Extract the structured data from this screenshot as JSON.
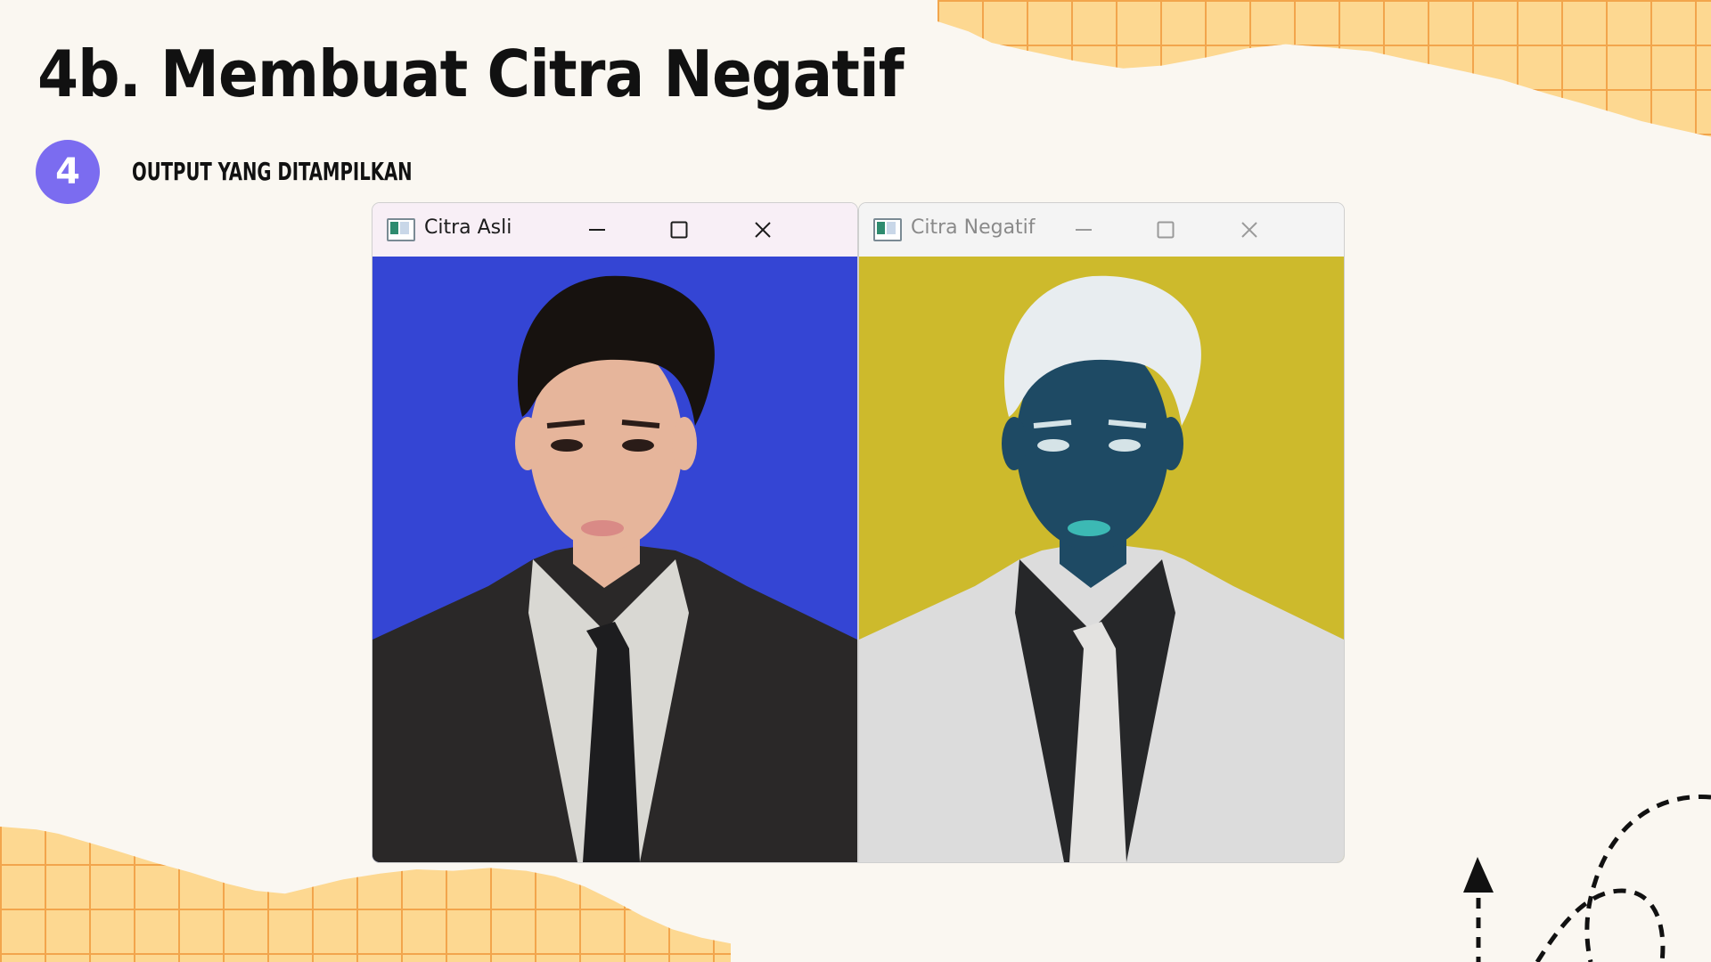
{
  "slide": {
    "title": "4b. Membuat Citra Negatif",
    "step": {
      "number": "4",
      "label": "OUTPUT YANG DITAMPILKAN"
    }
  },
  "windows": [
    {
      "title": "Citra Asli",
      "state": "active",
      "controls": [
        "minimize-icon",
        "maximize-icon",
        "close-icon"
      ],
      "image": {
        "background": "#3445d4",
        "hair": "#17120f",
        "skin": "#e6b59b",
        "suit": "#2a2828",
        "shirt": "#d9d8d3",
        "tie": "#1d1d1f"
      }
    },
    {
      "title": "Citra Negatif",
      "state": "inactive",
      "controls": [
        "minimize-icon",
        "maximize-icon",
        "close-icon"
      ],
      "image": {
        "background": "#cdba2c",
        "hair": "#e8edf0",
        "skin": "#1e4a64",
        "suit": "#dcdcdc",
        "shirt": "#262729",
        "tie": "#e3e2e0"
      }
    }
  ],
  "decorations": {
    "accent": "#7b6cf0",
    "paper_fill": "#fdd891",
    "paper_lines": "#f2a54c",
    "icons": [
      "arrow-up-icon",
      "dashed-loop-icon"
    ]
  }
}
